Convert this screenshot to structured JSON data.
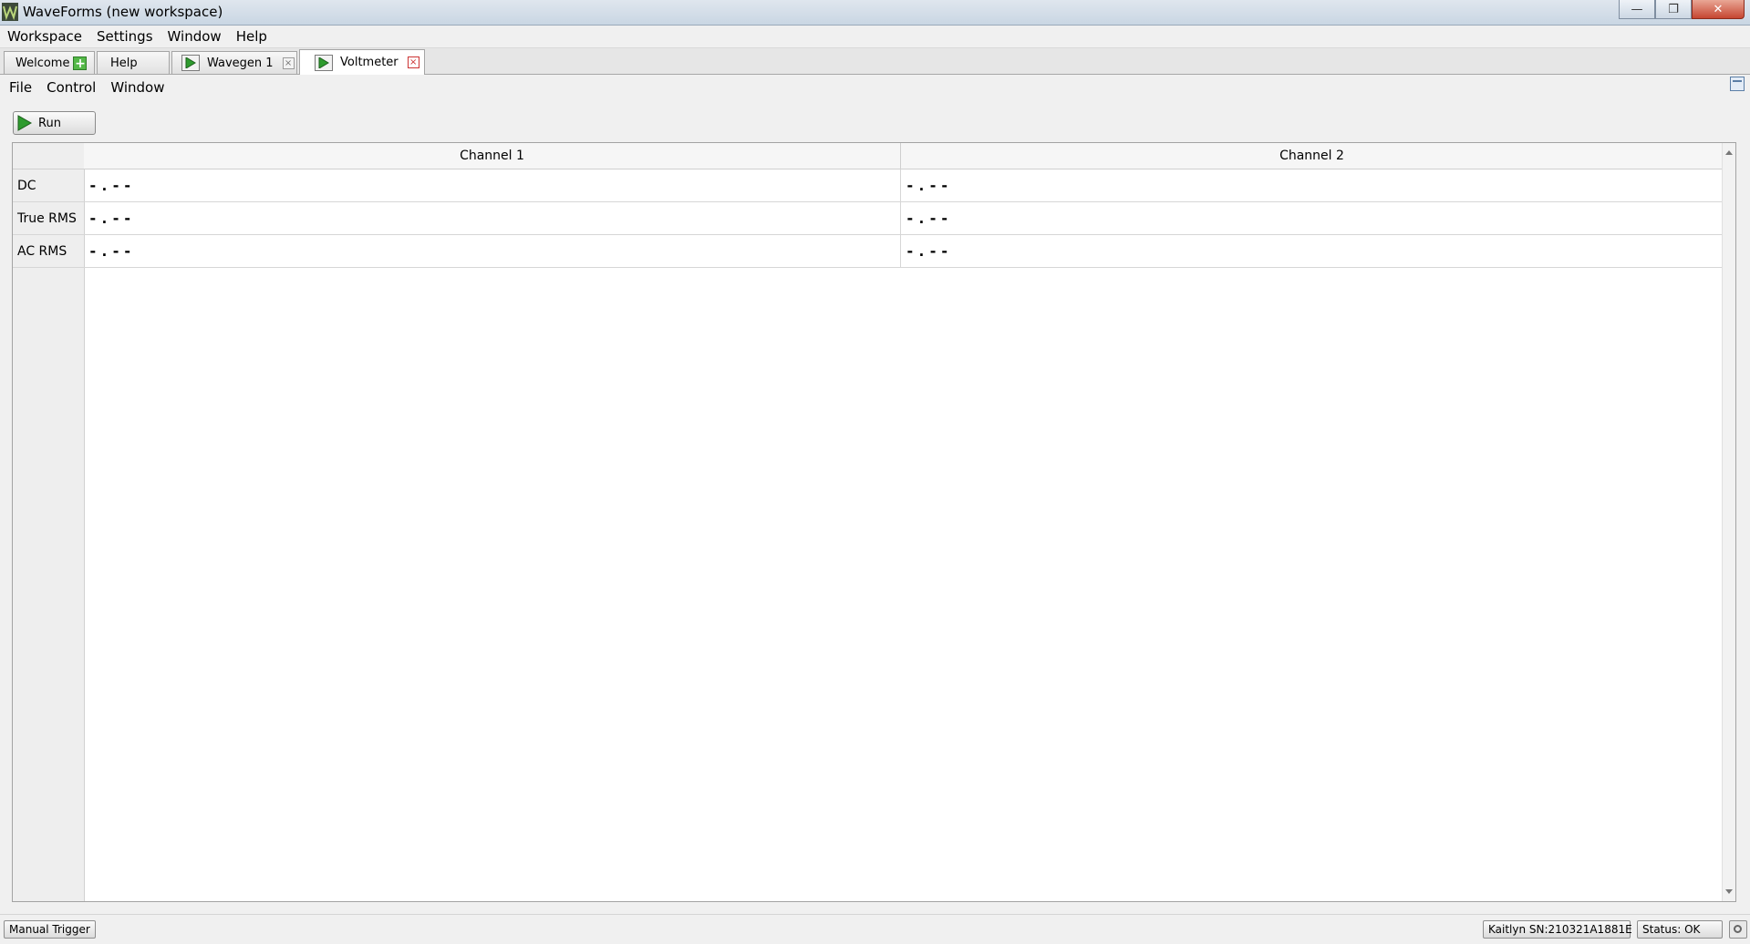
{
  "window": {
    "title": "WaveForms  (new workspace)",
    "minimize": "—",
    "maximize": "❐",
    "close": "✕"
  },
  "menubar": [
    "Workspace",
    "Settings",
    "Window",
    "Help"
  ],
  "tabs": [
    {
      "label": "Welcome",
      "active": false
    },
    {
      "label": "Help",
      "active": false
    },
    {
      "label": "Wavegen 1",
      "active": false
    },
    {
      "label": "Voltmeter",
      "active": true
    }
  ],
  "instrument_menu": [
    "File",
    "Control",
    "Window"
  ],
  "toolbar": {
    "run_label": "Run"
  },
  "table": {
    "columns": [
      "Channel 1",
      "Channel 2"
    ],
    "rows": [
      {
        "label": "DC",
        "values": [
          "-.--",
          "-.--"
        ]
      },
      {
        "label": "True RMS",
        "values": [
          "-.--",
          "-.--"
        ]
      },
      {
        "label": "AC RMS",
        "values": [
          "-.--",
          "-.--"
        ]
      }
    ]
  },
  "status": {
    "manual_trigger": "Manual Trigger",
    "device": "Kaitlyn SN:210321A1881E",
    "status": "Status: OK"
  },
  "colors": {
    "play_green": "#2e9b2e",
    "close_red": "#c64631"
  }
}
